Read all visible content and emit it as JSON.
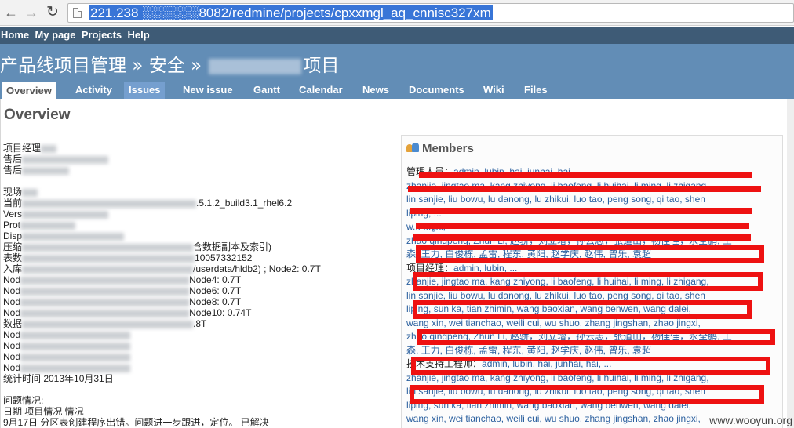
{
  "browser": {
    "url": "221.238 ░░░░░░8082/redmine/projects/cpxxmgl_aq_cnnisc327xm"
  },
  "top_menu": [
    "Home",
    "My page",
    "Projects",
    "Help"
  ],
  "header": {
    "title_prefix": "产品线项目管理 » 安全 »",
    "title_suffix": "项目"
  },
  "tabs": [
    {
      "label": "Overview",
      "selected": true
    },
    {
      "label": "Activity"
    },
    {
      "label": "Issues",
      "hover": true
    },
    {
      "label": "New issue"
    },
    {
      "label": "Gantt"
    },
    {
      "label": "Calendar"
    },
    {
      "label": "News"
    },
    {
      "label": "Documents"
    },
    {
      "label": "Wiki"
    },
    {
      "label": "Files"
    }
  ],
  "page_title": "Overview",
  "left_lines": [
    "项目经理",
    "售后",
    "售后",
    "",
    "现场",
    "当前",
    "Vers",
    "Prot",
    "Disp",
    "压缩",
    "表数",
    "入库",
    "Nod",
    "Nod",
    "Nod",
    "Nod",
    "数据",
    "Nod",
    "Nod",
    "Nod",
    "Nod",
    "统计时间 2013年10月31日",
    "",
    "问题情况:",
    "日期 项目情况 情况",
    "9月17日 分区表创建程序出错。问题进一步跟进，定位。 已解决"
  ],
  "left_tails": {
    "l5": ".5.1.2_build3.1_rhel6.2",
    "l9": "含数据副本及索引)",
    "l10": "10057332152",
    "l11": "/userdata/hldb2)  ; Node2: 0.7T",
    "l12": "Node4: 0.7T",
    "l13": "Node6: 0.7T",
    "l14": "Node8: 0.7T",
    "l15": "Node10: 0.74T",
    "l16": ".8T"
  },
  "members": {
    "title": "Members",
    "lines": [
      {
        "label": "管理人员：",
        "text": "admin, lubin,  hai, junhai, hai..."
      },
      {
        "label": "",
        "text": "zhanjie, jingtao ma, kang zhiyong, li baofeng, li huihai, li ming, li zhigang,"
      },
      {
        "label": "",
        "text": "lin sanjie, liu bowu, lu danong, lu zhikui, luo tao, peng song, qi tao, shen"
      },
      {
        "label": "",
        "text": "liping, ..."
      },
      {
        "label": "",
        "text": "w... ...gxi,"
      },
      {
        "label": "",
        "text": "zhao qingpeng, Zhun Li, 赵骄，刘立增，孙云志，张道山，杨佳佳，永全鹏, 王"
      },
      {
        "label": "",
        "text": "森, 王力, 白俊栋, 孟雷, 程东, 黄阳, 赵学庆, 赵伟, 曾乐, 袁超"
      },
      {
        "label": "项目经理：",
        "text": "admin, lubin, ..."
      },
      {
        "label": "",
        "text": "zhanjie, jingtao ma, kang zhiyong, li baofeng, li huihai, li ming, li zhigang,"
      },
      {
        "label": "",
        "text": "lin sanjie, liu bowu, lu danong, lu zhikui, luo tao, peng song, qi tao, shen"
      },
      {
        "label": "",
        "text": "liping, sun ka, tian zhimin, wang baoxian, wang benwen, wang dalei,"
      },
      {
        "label": "",
        "text": "wang xin, wei tianchao, weili cui, wu shuo, zhang jingshan, zhao jingxi,"
      },
      {
        "label": "",
        "text": "zhao qingpeng, Zhun Li, 赵骄，刘立增，孙云志，张道山，杨佳佳，永全鹏, 王"
      },
      {
        "label": "",
        "text": "森, 王力, 白俊栋, 孟雷, 程东, 黄阳, 赵学庆, 赵伟, 曾乐, 袁超"
      },
      {
        "label": "技术支持工程师：",
        "text": "admin, lubin, hai, junhai, hai, ..."
      },
      {
        "label": "",
        "text": "zhanjie, jingtao ma, kang zhiyong, li baofeng, li huihai, li ming, li zhigang,"
      },
      {
        "label": "",
        "text": "lin sanjie, liu bowu, lu danong, lu zhikui, luo tao, peng song, qi tao, shen"
      },
      {
        "label": "",
        "text": "liping, sun ka, tian zhimin, wang baoxian, wang benwen, wang dalei,"
      },
      {
        "label": "",
        "text": "wang xin, wei tianchao, weili cui, wu shuo, zhang jingshan, zhao jingxi,"
      }
    ]
  },
  "watermark": "www.wooyun.org",
  "colors": {
    "top_menu": "#3e5b76",
    "header": "#628db6",
    "redaction": "#ee1111",
    "link": "#2a5f9e"
  }
}
